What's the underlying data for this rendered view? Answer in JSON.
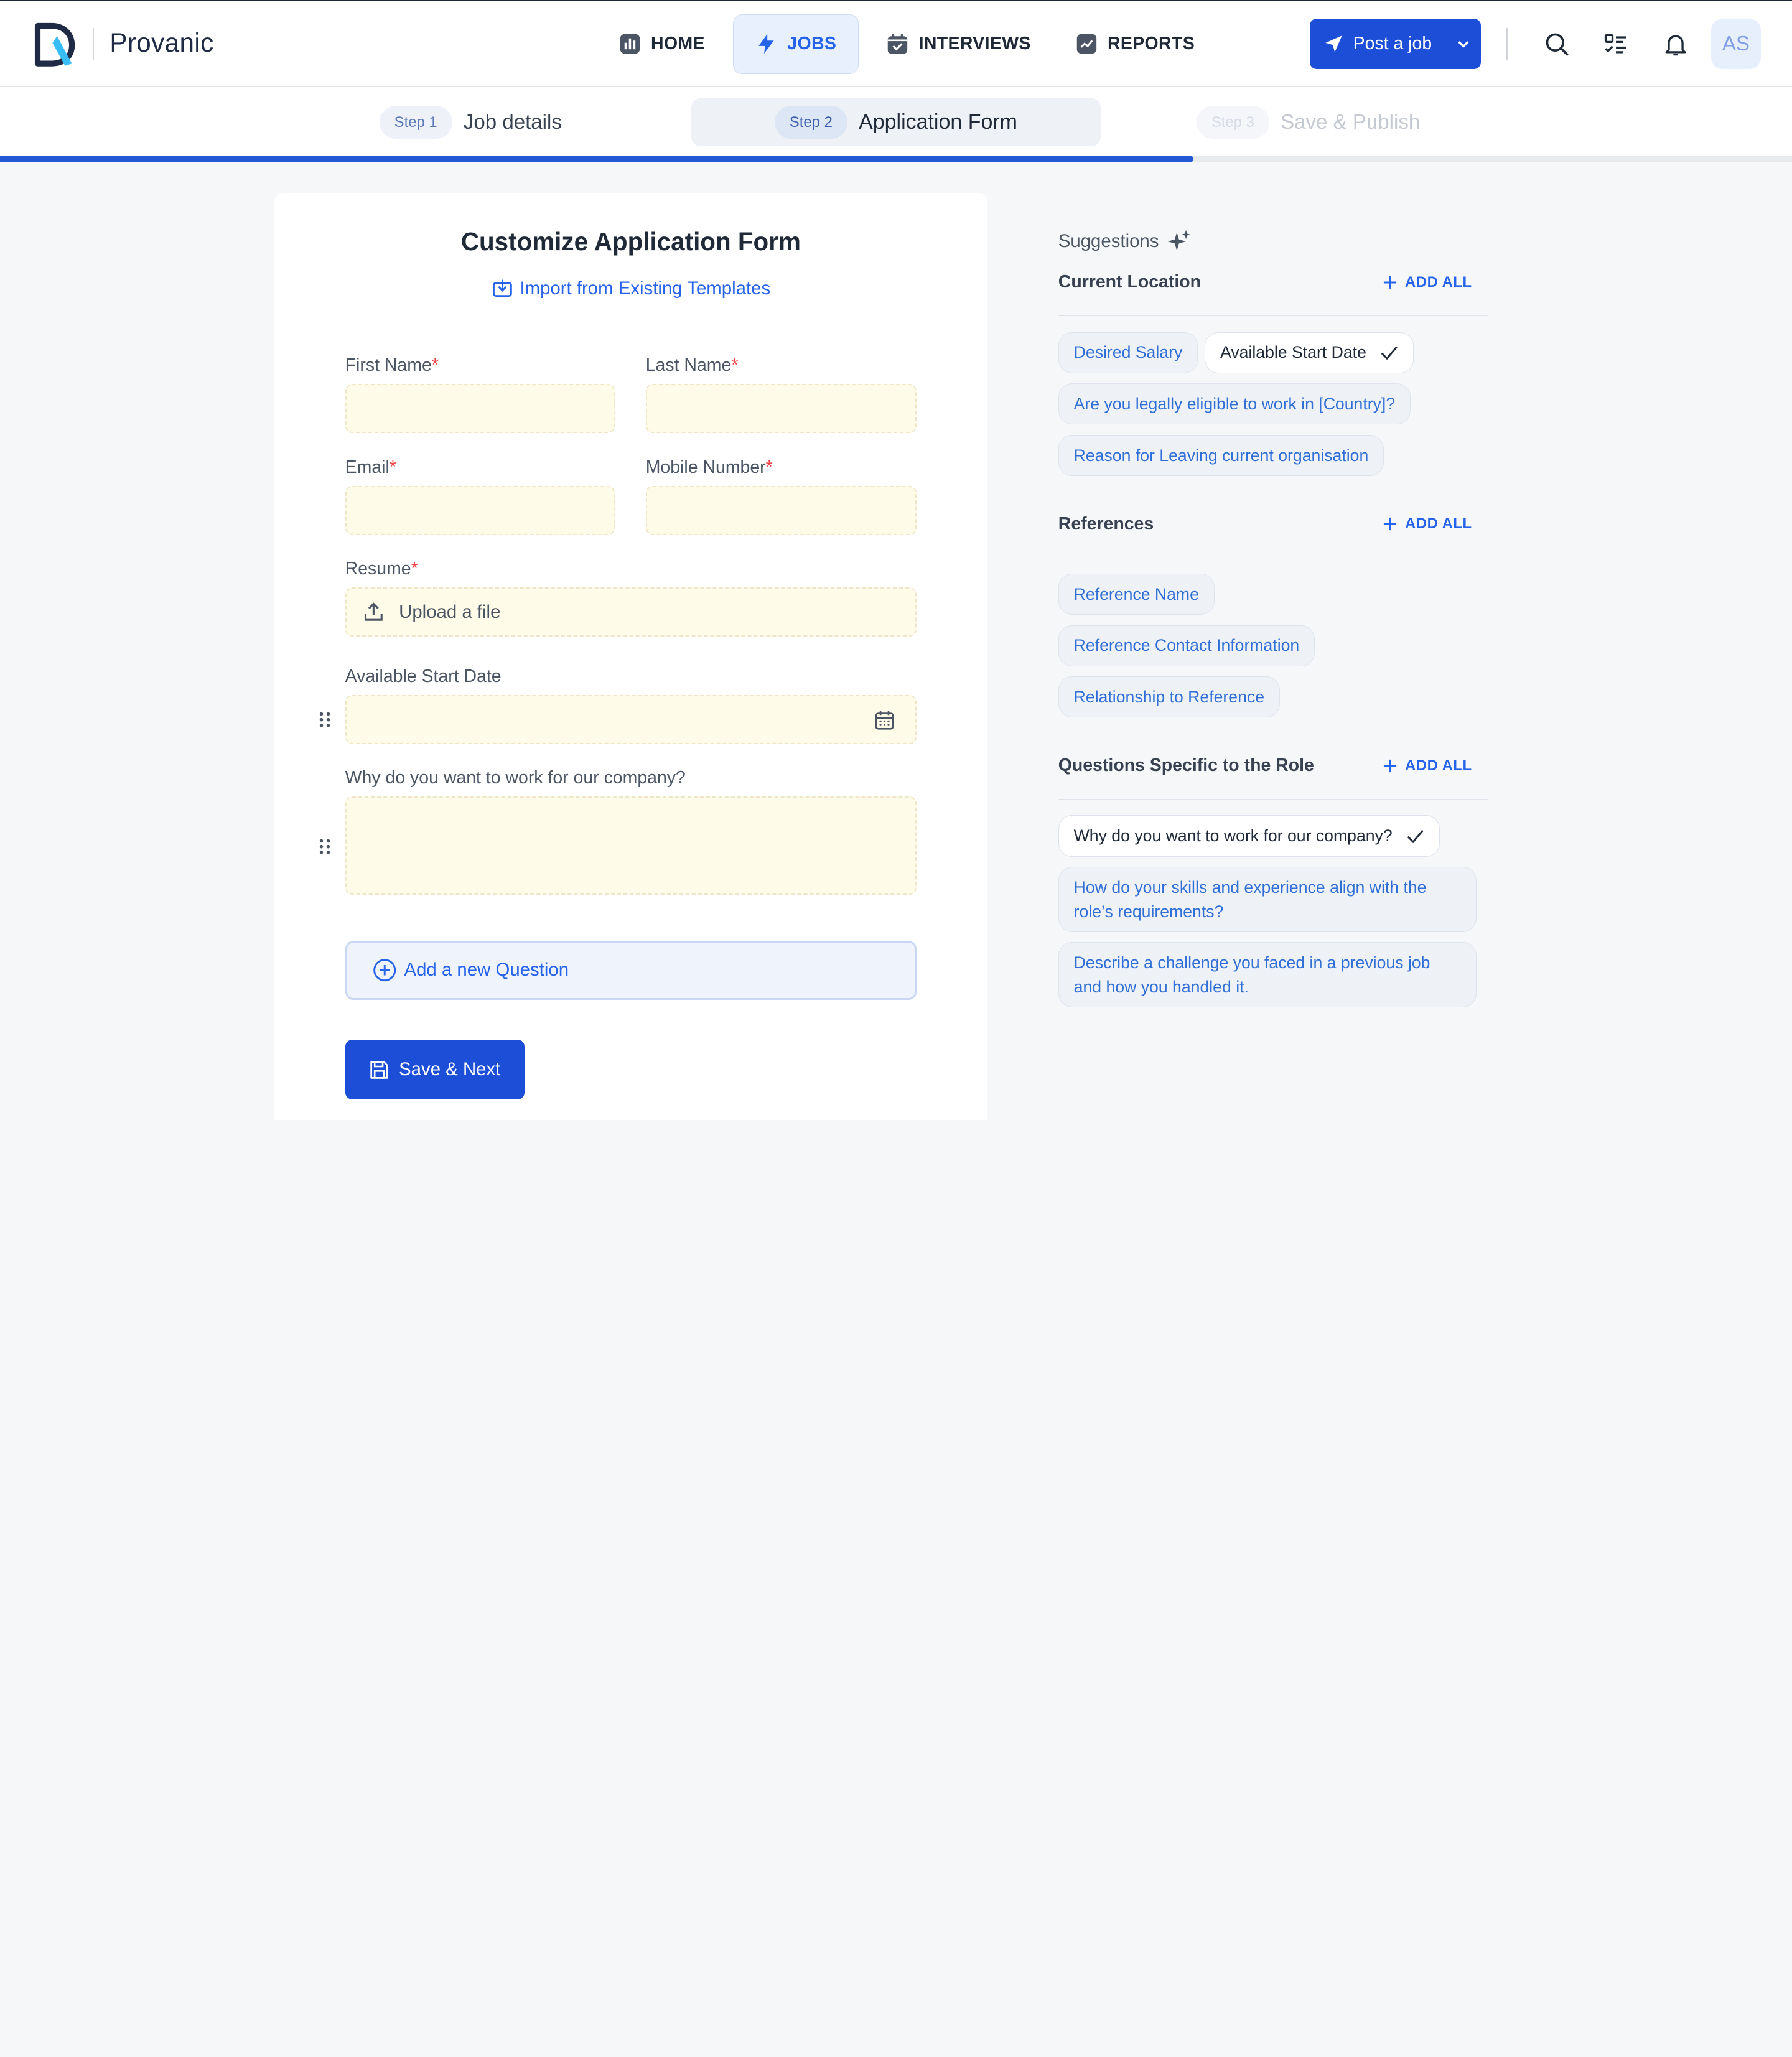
{
  "brand": {
    "name": "Provanic"
  },
  "nav": {
    "items": [
      {
        "label": "HOME",
        "icon": "chart-bars-icon"
      },
      {
        "label": "JOBS",
        "icon": "bolt-icon"
      },
      {
        "label": "INTERVIEWS",
        "icon": "calendar-check-icon"
      },
      {
        "label": "REPORTS",
        "icon": "trend-icon"
      }
    ],
    "active": "JOBS"
  },
  "header": {
    "post_job_label": "Post a job",
    "avatar_initials": "AS"
  },
  "stepper": {
    "steps": [
      {
        "pill": "Step 1",
        "label": "Job details",
        "state": "done"
      },
      {
        "pill": "Step 2",
        "label": "Application Form",
        "state": "active"
      },
      {
        "pill": "Step 3",
        "label": "Save & Publish",
        "state": "upcoming"
      }
    ],
    "progress": 0.666
  },
  "form": {
    "title": "Customize Application Form",
    "import_label": "Import from Existing Templates",
    "fields": {
      "first_name": {
        "label": "First Name",
        "required": "*"
      },
      "last_name": {
        "label": "Last Name",
        "required": "*"
      },
      "email": {
        "label": "Email",
        "required": "*"
      },
      "mobile": {
        "label": "Mobile Number",
        "required": "*"
      },
      "resume": {
        "label": "Resume",
        "required": "*",
        "placeholder": "Upload a file"
      },
      "start_date": {
        "label": "Available Start Date"
      },
      "why": {
        "label": "Why do you want to work for our company?"
      }
    },
    "add_question_label": "Add a new Question",
    "save_label": "Save & Next"
  },
  "suggestions": {
    "heading": "Suggestions",
    "add_all_label": "ADD ALL",
    "groups": [
      {
        "title": "Current Location",
        "chips": [
          {
            "label": "Desired Salary",
            "selected": false
          },
          {
            "label": "Available Start Date",
            "selected": true
          },
          {
            "label": "Are you legally eligible to work in [Country]?",
            "selected": false
          },
          {
            "label": "Reason for Leaving current organisation",
            "selected": false
          }
        ]
      },
      {
        "title": "References",
        "chips": [
          {
            "label": "Reference Name",
            "selected": false
          },
          {
            "label": "Reference Contact Information",
            "selected": false
          },
          {
            "label": "Relationship to Reference",
            "selected": false
          }
        ]
      },
      {
        "title": "Questions Specific to the Role",
        "chips": [
          {
            "label": "Why do you want to work for our company?",
            "selected": true
          },
          {
            "label": "How do your skills and experience align with the role’s requirements?",
            "selected": false
          },
          {
            "label": "Describe a challenge you faced in a previous job and how you handled it.",
            "selected": false
          }
        ]
      }
    ]
  },
  "colors": {
    "primary": "#1d4ed8",
    "link": "#2563eb",
    "input_bg": "#fefbe8",
    "page_bg": "#f6f7f9"
  }
}
